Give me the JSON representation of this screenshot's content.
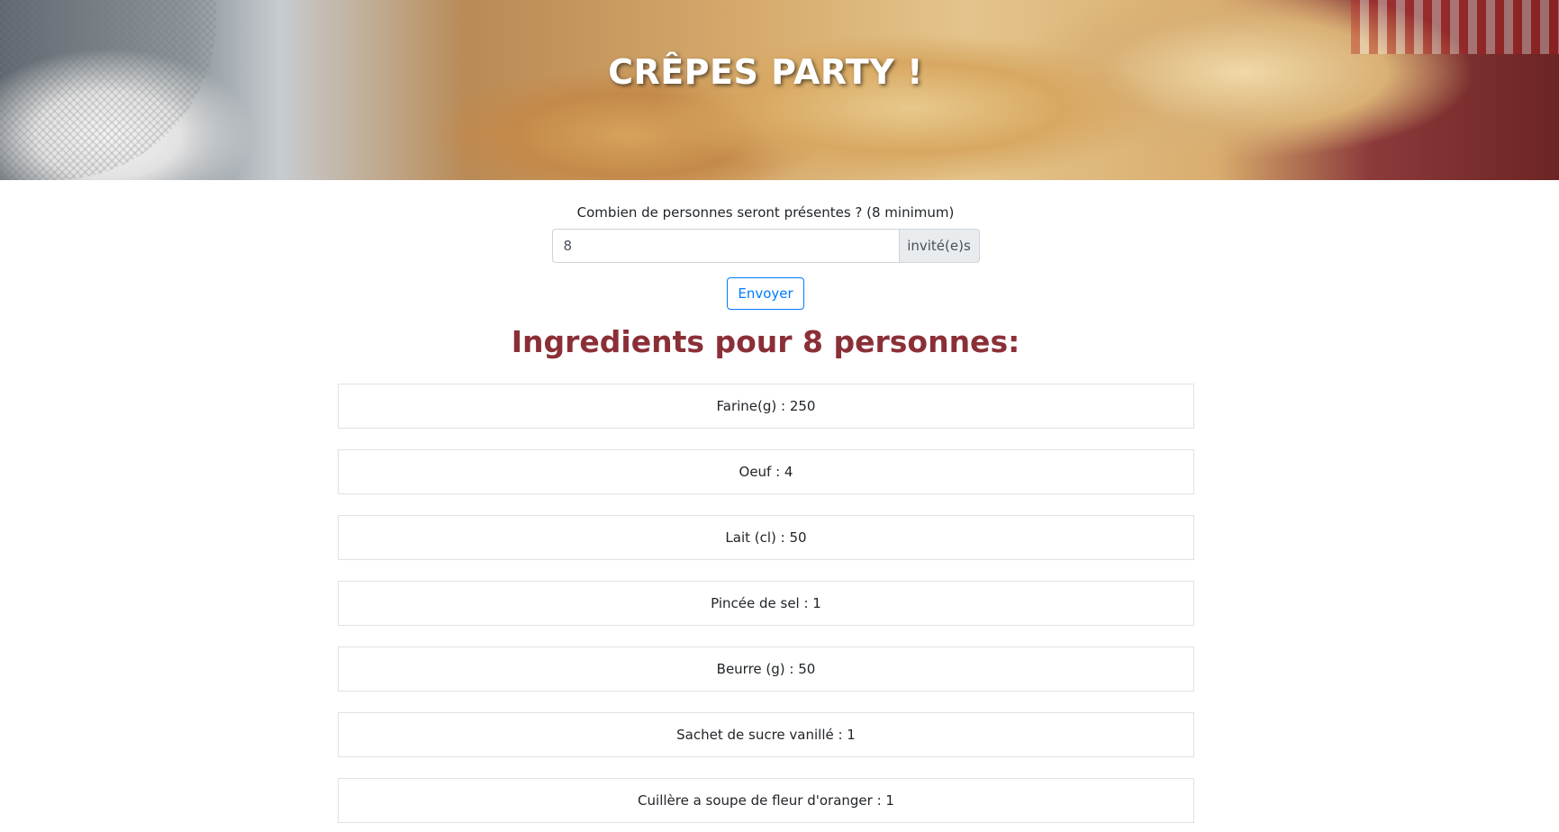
{
  "hero": {
    "title": "CRÊPES PARTY !"
  },
  "form": {
    "question": "Combien de personnes seront présentes ? (8 minimum)",
    "guests_value": "8",
    "guests_addon": "invité(e)s",
    "submit_label": "Envoyer"
  },
  "result": {
    "title": "Ingredients pour 8 personnes:",
    "ingredients": [
      "Farine(g) : 250",
      "Oeuf : 4",
      "Lait (cl) : 50",
      "Pincée de sel : 1",
      "Beurre (g) : 50",
      "Sachet de sucre vanillé : 1",
      "Cuillère a soupe de fleur d'oranger : 1"
    ]
  },
  "colors": {
    "title_color": "#8b2f37",
    "accent_blue": "#007bff"
  }
}
